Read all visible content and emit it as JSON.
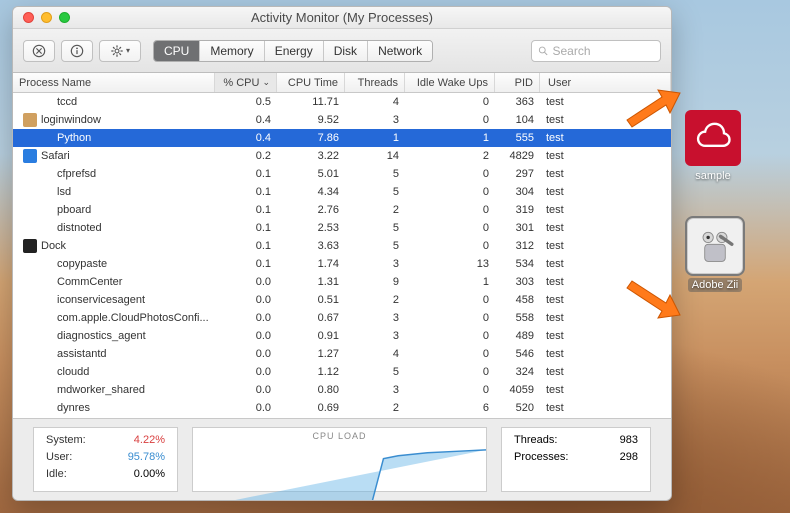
{
  "window": {
    "title": "Activity Monitor (My Processes)"
  },
  "toolbar": {
    "tabs": [
      "CPU",
      "Memory",
      "Energy",
      "Disk",
      "Network"
    ],
    "active_tab": 0,
    "search_placeholder": "Search"
  },
  "columns": {
    "name": "Process Name",
    "cpu": "% CPU",
    "time": "CPU Time",
    "threads": "Threads",
    "idle": "Idle Wake Ups",
    "pid": "PID",
    "user": "User"
  },
  "rows": [
    {
      "name": "tccd",
      "cpu": "0.5",
      "time": "11.71",
      "threads": "4",
      "idle": "0",
      "pid": "363",
      "user": "test",
      "indent": true
    },
    {
      "name": "loginwindow",
      "cpu": "0.4",
      "time": "9.52",
      "threads": "3",
      "idle": "0",
      "pid": "104",
      "user": "test",
      "icon": "login"
    },
    {
      "name": "Python",
      "cpu": "0.4",
      "time": "7.86",
      "threads": "1",
      "idle": "1",
      "pid": "555",
      "user": "test",
      "indent": true,
      "selected": true
    },
    {
      "name": "Safari",
      "cpu": "0.2",
      "time": "3.22",
      "threads": "14",
      "idle": "2",
      "pid": "4829",
      "user": "test",
      "icon": "safari"
    },
    {
      "name": "cfprefsd",
      "cpu": "0.1",
      "time": "5.01",
      "threads": "5",
      "idle": "0",
      "pid": "297",
      "user": "test",
      "indent": true
    },
    {
      "name": "lsd",
      "cpu": "0.1",
      "time": "4.34",
      "threads": "5",
      "idle": "0",
      "pid": "304",
      "user": "test",
      "indent": true
    },
    {
      "name": "pboard",
      "cpu": "0.1",
      "time": "2.76",
      "threads": "2",
      "idle": "0",
      "pid": "319",
      "user": "test",
      "indent": true
    },
    {
      "name": "distnoted",
      "cpu": "0.1",
      "time": "2.53",
      "threads": "5",
      "idle": "0",
      "pid": "301",
      "user": "test",
      "indent": true
    },
    {
      "name": "Dock",
      "cpu": "0.1",
      "time": "3.63",
      "threads": "5",
      "idle": "0",
      "pid": "312",
      "user": "test",
      "icon": "dock"
    },
    {
      "name": "copypaste",
      "cpu": "0.1",
      "time": "1.74",
      "threads": "3",
      "idle": "13",
      "pid": "534",
      "user": "test",
      "indent": true
    },
    {
      "name": "CommCenter",
      "cpu": "0.0",
      "time": "1.31",
      "threads": "9",
      "idle": "1",
      "pid": "303",
      "user": "test",
      "indent": true
    },
    {
      "name": "iconservicesagent",
      "cpu": "0.0",
      "time": "0.51",
      "threads": "2",
      "idle": "0",
      "pid": "458",
      "user": "test",
      "indent": true
    },
    {
      "name": "com.apple.CloudPhotosConfi...",
      "cpu": "0.0",
      "time": "0.67",
      "threads": "3",
      "idle": "0",
      "pid": "558",
      "user": "test",
      "indent": true
    },
    {
      "name": "diagnostics_agent",
      "cpu": "0.0",
      "time": "0.91",
      "threads": "3",
      "idle": "0",
      "pid": "489",
      "user": "test",
      "indent": true
    },
    {
      "name": "assistantd",
      "cpu": "0.0",
      "time": "1.27",
      "threads": "4",
      "idle": "0",
      "pid": "546",
      "user": "test",
      "indent": true
    },
    {
      "name": "cloudd",
      "cpu": "0.0",
      "time": "1.12",
      "threads": "5",
      "idle": "0",
      "pid": "324",
      "user": "test",
      "indent": true
    },
    {
      "name": "mdworker_shared",
      "cpu": "0.0",
      "time": "0.80",
      "threads": "3",
      "idle": "0",
      "pid": "4059",
      "user": "test",
      "indent": true
    },
    {
      "name": "dynres",
      "cpu": "0.0",
      "time": "0.69",
      "threads": "2",
      "idle": "6",
      "pid": "520",
      "user": "test",
      "indent": true
    }
  ],
  "footer": {
    "system_label": "System:",
    "system_value": "4.22%",
    "user_label": "User:",
    "user_value": "95.78%",
    "idle_label": "Idle:",
    "idle_value": "0.00%",
    "graph_label": "CPU LOAD",
    "threads_label": "Threads:",
    "threads_value": "983",
    "processes_label": "Processes:",
    "processes_value": "298"
  },
  "desktop": {
    "sample_label": "sample",
    "zii_label": "Adobe Zii"
  }
}
